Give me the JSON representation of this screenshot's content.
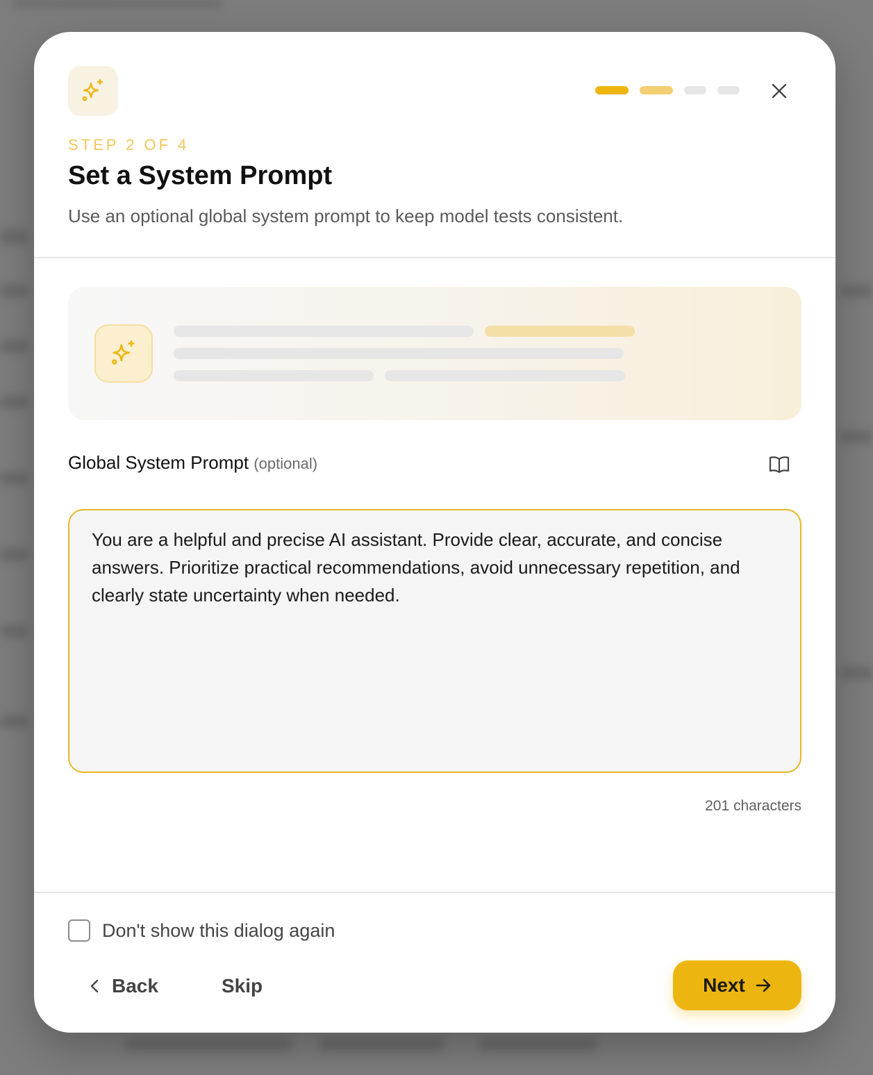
{
  "colors": {
    "accent": "#edb50f",
    "accent_light": "#f0c75a",
    "progress_inactive": "#e6e6e6"
  },
  "dialog": {
    "header": {
      "app_icon": "sparkle-icon",
      "progress_steps": [
        {
          "state": "active",
          "color": "#edb50f"
        },
        {
          "state": "active",
          "color": "#f2cf72"
        },
        {
          "state": "inactive",
          "color": "#e6e6e6"
        },
        {
          "state": "inactive",
          "color": "#e6e6e6"
        }
      ],
      "close_icon": "close-icon",
      "step_label": "STEP 2 OF 4",
      "title": "Set a System Prompt",
      "subtitle": "Use an optional global system prompt to keep model tests consistent."
    },
    "hero": {
      "icon": "sparkle-icon"
    },
    "field": {
      "label": "Global System Prompt",
      "optional_label": "(optional)",
      "doc_icon": "book-icon",
      "value": "You are a helpful and precise AI assistant. Provide clear, accurate, and concise answers. Prioritize practical recommendations, avoid unnecessary repetition, and clearly state uncertainty when needed.",
      "char_count": "201 characters"
    },
    "footer": {
      "checkbox_label": "Don't show this dialog again",
      "checkbox_checked": false,
      "back_label": "Back",
      "skip_label": "Skip",
      "next_label": "Next"
    }
  }
}
